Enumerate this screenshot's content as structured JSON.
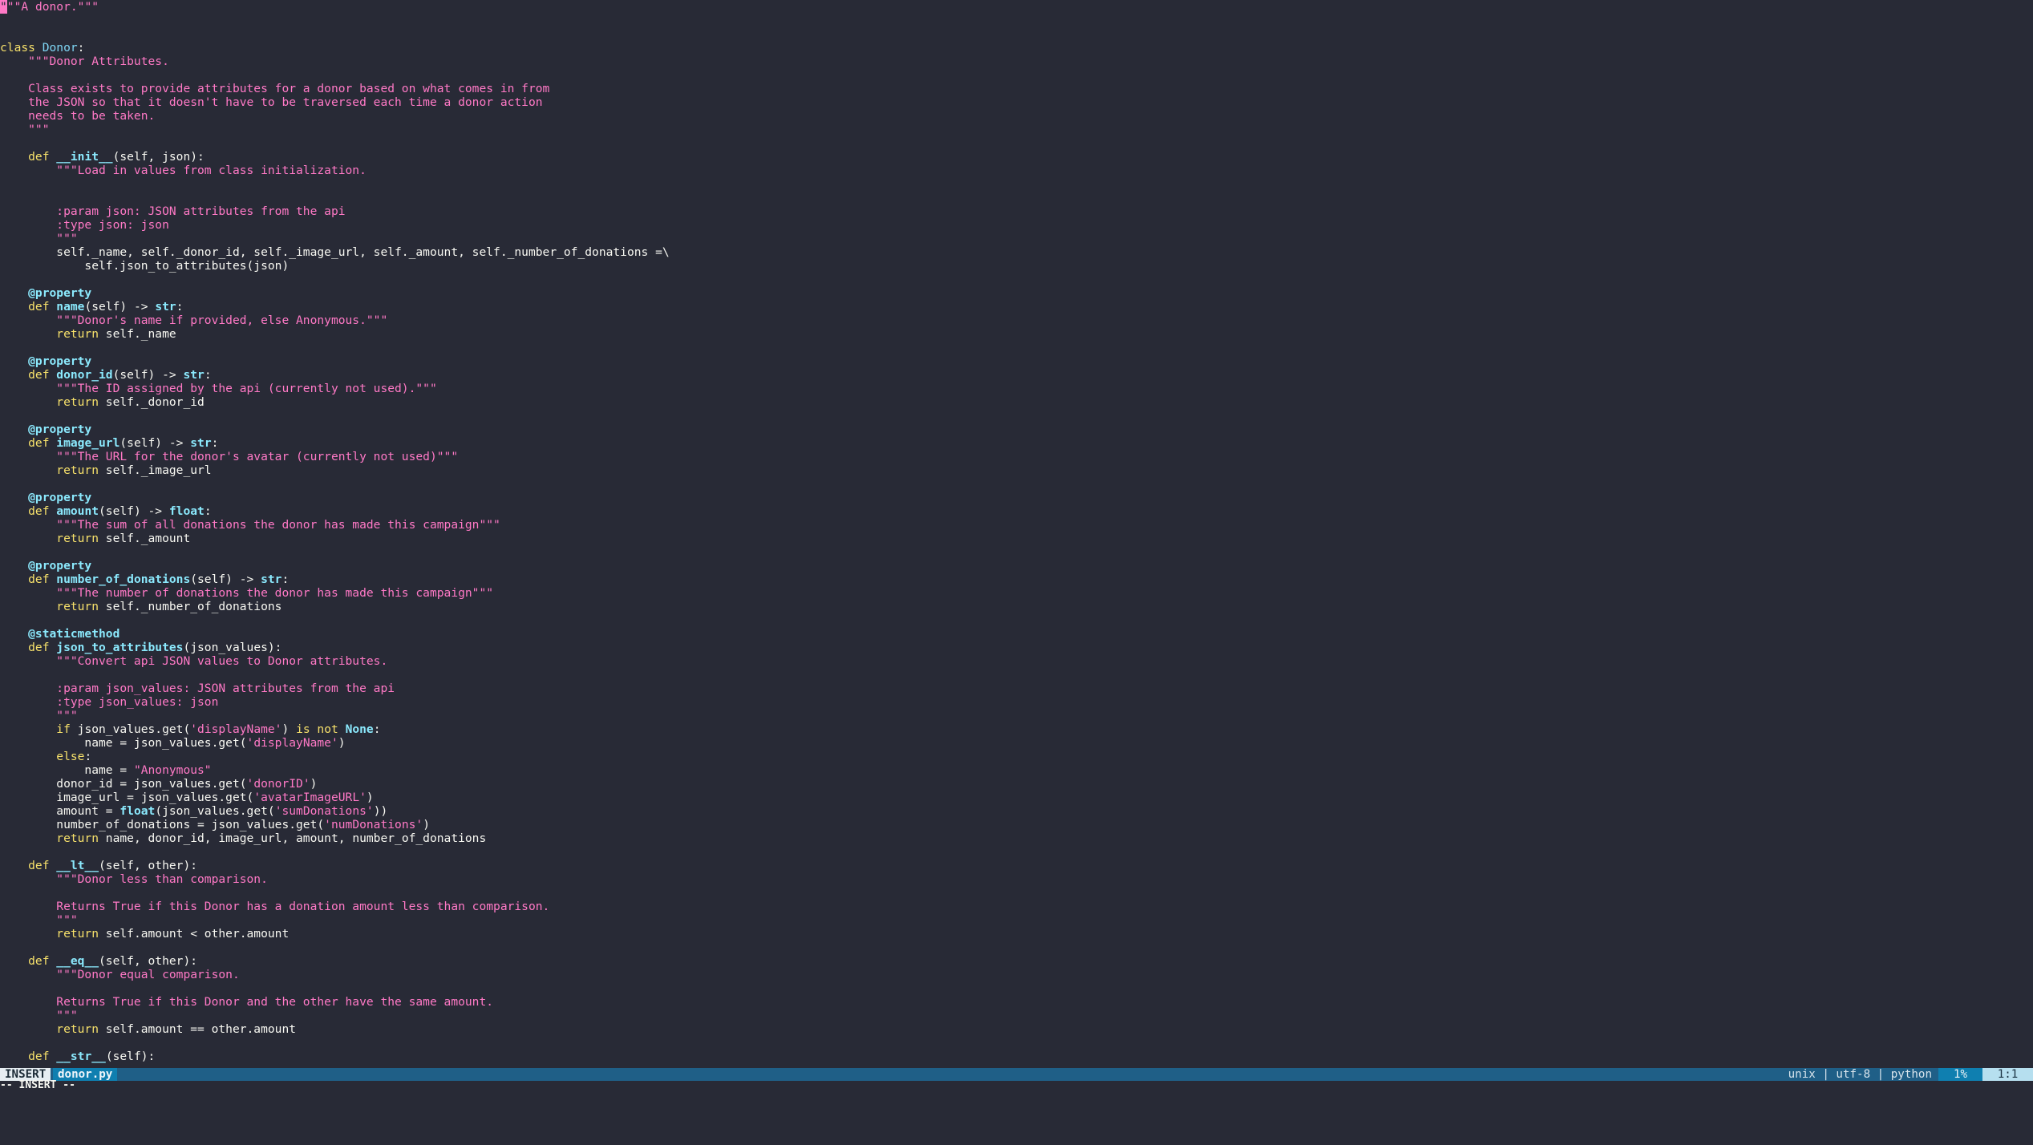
{
  "editor": {
    "lines": [
      [
        [
          "string",
          "\"\"\"A donor.\"\"\""
        ]
      ],
      [],
      [],
      [
        [
          "keyword",
          "class "
        ],
        [
          "class",
          "Donor"
        ],
        [
          "plain",
          ":"
        ]
      ],
      [
        [
          "string",
          "    \"\"\"Donor Attributes."
        ]
      ],
      [],
      [
        [
          "string",
          "    Class exists to provide attributes for a donor based on what comes in from"
        ]
      ],
      [
        [
          "string",
          "    the JSON so that it doesn't have to be traversed each time a donor action"
        ]
      ],
      [
        [
          "string",
          "    needs to be taken."
        ]
      ],
      [
        [
          "string",
          "    \"\"\""
        ]
      ],
      [],
      [
        [
          "def",
          "    def "
        ],
        [
          "func",
          "__init__"
        ],
        [
          "plain",
          "(self, json):"
        ]
      ],
      [
        [
          "string",
          "        \"\"\"Load in values from class initialization."
        ]
      ],
      [],
      [],
      [
        [
          "string",
          "        :param json: JSON attributes from the api"
        ]
      ],
      [
        [
          "string",
          "        :type json: json"
        ]
      ],
      [
        [
          "string",
          "        \"\"\""
        ]
      ],
      [
        [
          "plain",
          "        self._name, self._donor_id, self._image_url, self._amount, self._number_of_donations =\\"
        ]
      ],
      [
        [
          "plain",
          "            self.json_to_attributes(json)"
        ]
      ],
      [],
      [
        [
          "decorator",
          "    @property"
        ]
      ],
      [
        [
          "def",
          "    def "
        ],
        [
          "func",
          "name"
        ],
        [
          "plain",
          "(self) -> "
        ],
        [
          "builtin",
          "str"
        ],
        [
          "plain",
          ":"
        ]
      ],
      [
        [
          "string",
          "        \"\"\"Donor's name if provided, else Anonymous.\"\"\""
        ]
      ],
      [
        [
          "keyword",
          "        return "
        ],
        [
          "plain",
          "self._name"
        ]
      ],
      [],
      [
        [
          "decorator",
          "    @property"
        ]
      ],
      [
        [
          "def",
          "    def "
        ],
        [
          "func",
          "donor_id"
        ],
        [
          "plain",
          "(self) -> "
        ],
        [
          "builtin",
          "str"
        ],
        [
          "plain",
          ":"
        ]
      ],
      [
        [
          "string",
          "        \"\"\"The ID assigned by the api (currently not used).\"\"\""
        ]
      ],
      [
        [
          "keyword",
          "        return "
        ],
        [
          "plain",
          "self._donor_id"
        ]
      ],
      [],
      [
        [
          "decorator",
          "    @property"
        ]
      ],
      [
        [
          "def",
          "    def "
        ],
        [
          "func",
          "image_url"
        ],
        [
          "plain",
          "(self) -> "
        ],
        [
          "builtin",
          "str"
        ],
        [
          "plain",
          ":"
        ]
      ],
      [
        [
          "string",
          "        \"\"\"The URL for the donor's avatar (currently not used)\"\"\""
        ]
      ],
      [
        [
          "keyword",
          "        return "
        ],
        [
          "plain",
          "self._image_url"
        ]
      ],
      [],
      [
        [
          "decorator",
          "    @property"
        ]
      ],
      [
        [
          "def",
          "    def "
        ],
        [
          "func",
          "amount"
        ],
        [
          "plain",
          "(self) -> "
        ],
        [
          "builtin",
          "float"
        ],
        [
          "plain",
          ":"
        ]
      ],
      [
        [
          "string",
          "        \"\"\"The sum of all donations the donor has made this campaign\"\"\""
        ]
      ],
      [
        [
          "keyword",
          "        return "
        ],
        [
          "plain",
          "self._amount"
        ]
      ],
      [],
      [
        [
          "decorator",
          "    @property"
        ]
      ],
      [
        [
          "def",
          "    def "
        ],
        [
          "func",
          "number_of_donations"
        ],
        [
          "plain",
          "(self) -> "
        ],
        [
          "builtin",
          "str"
        ],
        [
          "plain",
          ":"
        ]
      ],
      [
        [
          "string",
          "        \"\"\"The number of donations the donor has made this campaign\"\"\""
        ]
      ],
      [
        [
          "keyword",
          "        return "
        ],
        [
          "plain",
          "self._number_of_donations"
        ]
      ],
      [],
      [
        [
          "decorator",
          "    @staticmethod"
        ]
      ],
      [
        [
          "def",
          "    def "
        ],
        [
          "func",
          "json_to_attributes"
        ],
        [
          "plain",
          "(json_values):"
        ]
      ],
      [
        [
          "string",
          "        \"\"\"Convert api JSON values to Donor attributes."
        ]
      ],
      [],
      [
        [
          "string",
          "        :param json_values: JSON attributes from the api"
        ]
      ],
      [
        [
          "string",
          "        :type json_values: json"
        ]
      ],
      [
        [
          "string",
          "        \"\"\""
        ]
      ],
      [
        [
          "keyword",
          "        if "
        ],
        [
          "plain",
          "json_values.get("
        ],
        [
          "string",
          "'displayName'"
        ],
        [
          "plain",
          ") "
        ],
        [
          "keyword",
          "is not "
        ],
        [
          "builtin",
          "None"
        ],
        [
          "plain",
          ":"
        ]
      ],
      [
        [
          "plain",
          "            name = json_values.get("
        ],
        [
          "string",
          "'displayName'"
        ],
        [
          "plain",
          ")"
        ]
      ],
      [
        [
          "keyword",
          "        else"
        ],
        [
          "plain",
          ":"
        ]
      ],
      [
        [
          "plain",
          "            name = "
        ],
        [
          "string",
          "\"Anonymous\""
        ]
      ],
      [
        [
          "plain",
          "        donor_id = json_values.get("
        ],
        [
          "string",
          "'donorID'"
        ],
        [
          "plain",
          ")"
        ]
      ],
      [
        [
          "plain",
          "        image_url = json_values.get("
        ],
        [
          "string",
          "'avatarImageURL'"
        ],
        [
          "plain",
          ")"
        ]
      ],
      [
        [
          "plain",
          "        amount = "
        ],
        [
          "builtin",
          "float"
        ],
        [
          "plain",
          "(json_values.get("
        ],
        [
          "string",
          "'sumDonations'"
        ],
        [
          "plain",
          "))"
        ]
      ],
      [
        [
          "plain",
          "        number_of_donations = json_values.get("
        ],
        [
          "string",
          "'numDonations'"
        ],
        [
          "plain",
          ")"
        ]
      ],
      [
        [
          "keyword",
          "        return "
        ],
        [
          "plain",
          "name, donor_id, image_url, amount, number_of_donations"
        ]
      ],
      [],
      [
        [
          "def",
          "    def "
        ],
        [
          "func",
          "__lt__"
        ],
        [
          "plain",
          "(self, other):"
        ]
      ],
      [
        [
          "string",
          "        \"\"\"Donor less than comparison."
        ]
      ],
      [],
      [
        [
          "string",
          "        Returns True if this Donor has a donation amount less than comparison."
        ]
      ],
      [
        [
          "string",
          "        \"\"\""
        ]
      ],
      [
        [
          "keyword",
          "        return "
        ],
        [
          "plain",
          "self.amount < other.amount"
        ]
      ],
      [],
      [
        [
          "def",
          "    def "
        ],
        [
          "func",
          "__eq__"
        ],
        [
          "plain",
          "(self, other):"
        ]
      ],
      [
        [
          "string",
          "        \"\"\"Donor equal comparison."
        ]
      ],
      [],
      [
        [
          "string",
          "        Returns True if this Donor and the other have the same amount."
        ]
      ],
      [
        [
          "string",
          "        \"\"\""
        ]
      ],
      [
        [
          "keyword",
          "        return "
        ],
        [
          "plain",
          "self.amount == other.amount"
        ]
      ],
      [],
      [
        [
          "def",
          "    def "
        ],
        [
          "func",
          "__str__"
        ],
        [
          "plain",
          "(self):"
        ]
      ]
    ]
  },
  "statusline": {
    "mode": "INSERT",
    "filename": "donor.py",
    "fileformat": "unix",
    "encoding": "utf-8",
    "filetype": "python",
    "info": "unix | utf-8 | python",
    "percent": "1%",
    "position": "1:1"
  },
  "cmdline": {
    "text": "-- INSERT --"
  },
  "colors": {
    "background": "#282a36",
    "keyword": "#f7e16b",
    "string": "#ff79c6",
    "function": "#8be9fd",
    "statusline": "#1f5f87"
  }
}
